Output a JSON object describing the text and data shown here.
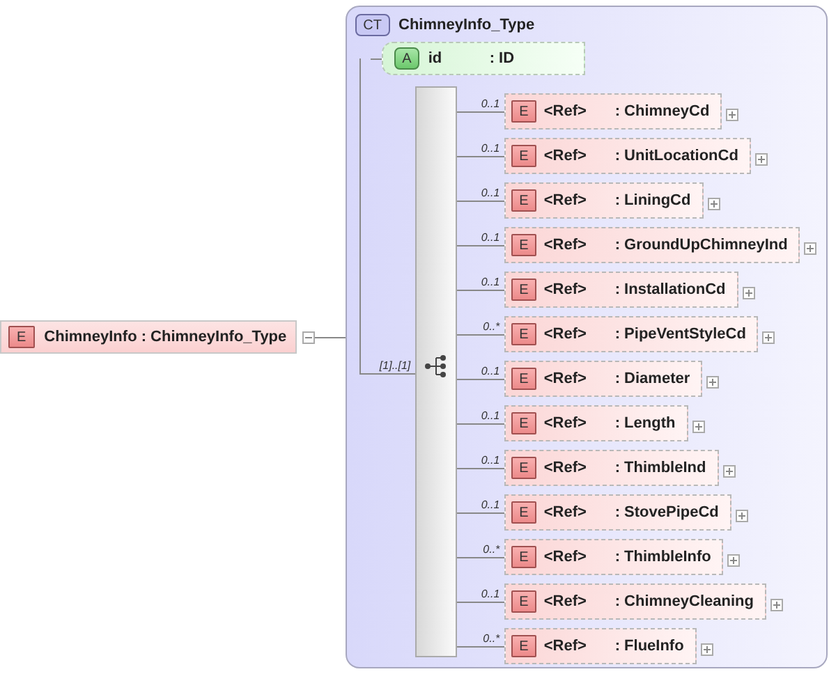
{
  "root_element": {
    "badge": "E",
    "label": "ChimneyInfo : ChimneyInfo_Type",
    "expanded": true
  },
  "complex_type": {
    "badge": "CT",
    "name": "ChimneyInfo_Type",
    "attribute": {
      "badge": "A",
      "name": "id",
      "type": ": ID"
    },
    "sequence": {
      "occurrence": "[1]..[1]",
      "elements": [
        {
          "occurrence": "0..1",
          "badge": "E",
          "ref": "<Ref>",
          "type": ": ChimneyCd",
          "expanded": false
        },
        {
          "occurrence": "0..1",
          "badge": "E",
          "ref": "<Ref>",
          "type": ": UnitLocationCd",
          "expanded": false
        },
        {
          "occurrence": "0..1",
          "badge": "E",
          "ref": "<Ref>",
          "type": ": LiningCd",
          "expanded": false
        },
        {
          "occurrence": "0..1",
          "badge": "E",
          "ref": "<Ref>",
          "type": ": GroundUpChimneyInd",
          "expanded": false
        },
        {
          "occurrence": "0..1",
          "badge": "E",
          "ref": "<Ref>",
          "type": ": InstallationCd",
          "expanded": false
        },
        {
          "occurrence": "0..*",
          "badge": "E",
          "ref": "<Ref>",
          "type": ": PipeVentStyleCd",
          "expanded": false
        },
        {
          "occurrence": "0..1",
          "badge": "E",
          "ref": "<Ref>",
          "type": ": Diameter",
          "expanded": false
        },
        {
          "occurrence": "0..1",
          "badge": "E",
          "ref": "<Ref>",
          "type": ": Length",
          "expanded": false
        },
        {
          "occurrence": "0..1",
          "badge": "E",
          "ref": "<Ref>",
          "type": ": ThimbleInd",
          "expanded": false
        },
        {
          "occurrence": "0..1",
          "badge": "E",
          "ref": "<Ref>",
          "type": ": StovePipeCd",
          "expanded": false
        },
        {
          "occurrence": "0..*",
          "badge": "E",
          "ref": "<Ref>",
          "type": ": ThimbleInfo",
          "expanded": false
        },
        {
          "occurrence": "0..1",
          "badge": "E",
          "ref": "<Ref>",
          "type": ": ChimneyCleaning",
          "expanded": false
        },
        {
          "occurrence": "0..*",
          "badge": "E",
          "ref": "<Ref>",
          "type": ": FlueInfo",
          "expanded": false
        }
      ]
    }
  }
}
